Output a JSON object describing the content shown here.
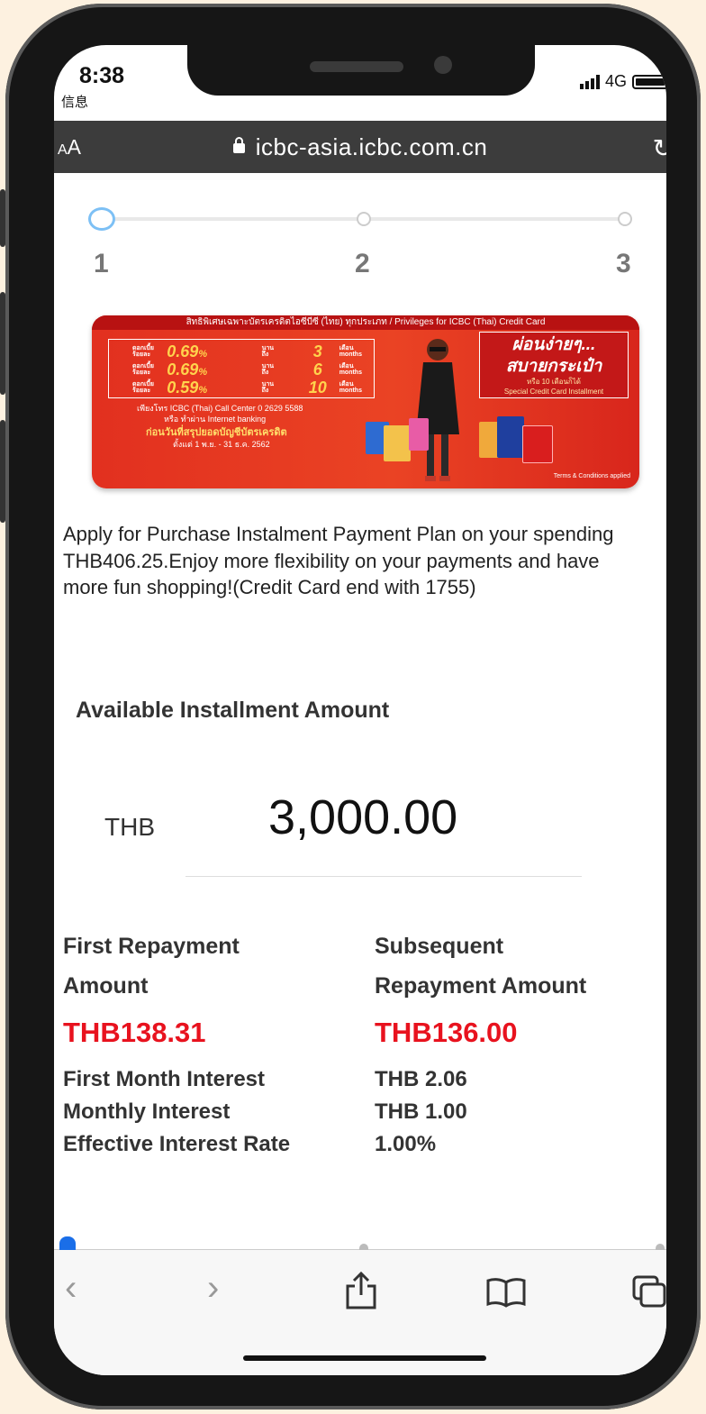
{
  "status_bar": {
    "time": "8:38",
    "back_app": "信息",
    "network": "4G"
  },
  "browser": {
    "text_size": "AA",
    "url": "icbc-asia.icbc.com.cn"
  },
  "steps": [
    "1",
    "2",
    "3"
  ],
  "banner": {
    "header": "สิทธิพิเศษเฉพาะบัตรเครดิตไอซีบีซี (ไทย) ทุกประเภท / Privileges for ICBC (Thai) Credit Card",
    "rates": [
      {
        "rate": "0.69",
        "months": "3"
      },
      {
        "rate": "0.69",
        "months": "6"
      },
      {
        "rate": "0.59",
        "months": "10"
      }
    ],
    "call_center": "เพียงโทร ICBC (Thai) Call Center 0 2629 5588",
    "internet": "หรือ ทำผ่าน Internet banking",
    "thai_offer": "ก่อนวันที่สรุปยอดบัญชีบัตรเครดิต",
    "period": "ตั้งแต่ 1 พ.ย. - 31 ธ.ค. 2562",
    "promo_title": "ผ่อนง่ายๆ...",
    "promo_title2": "สบายกระเป๋า",
    "promo_sub": "หรือ 10 เดือนก็ได้",
    "promo_en": "Special Credit Card Installment",
    "terms": "Terms & Conditions applied"
  },
  "description": "Apply for Purchase Instalment Payment Plan on your spending THB406.25.Enjoy more flexibility on your payments and have more fun shopping!(Credit Card end with 1755)",
  "available": {
    "title": "Available Installment Amount",
    "currency": "THB",
    "amount": "3,000.00"
  },
  "repayment": {
    "first_title_1": "First Repayment",
    "first_title_2": "Amount",
    "first_amount": "THB138.31",
    "subsequent_title_1": "Subsequent",
    "subsequent_title_2": "Repayment Amount",
    "subsequent_amount": "THB136.00"
  },
  "details": [
    {
      "label": "First Month Interest",
      "value": "THB 2.06"
    },
    {
      "label": "Monthly Interest",
      "value": "THB 1.00"
    },
    {
      "label": "Effective Interest Rate",
      "value": "1.00%"
    }
  ],
  "colors": {
    "accent_red": "#e8121e",
    "url_bar": "#3c3c3c",
    "step_active": "#6ab6ff"
  }
}
